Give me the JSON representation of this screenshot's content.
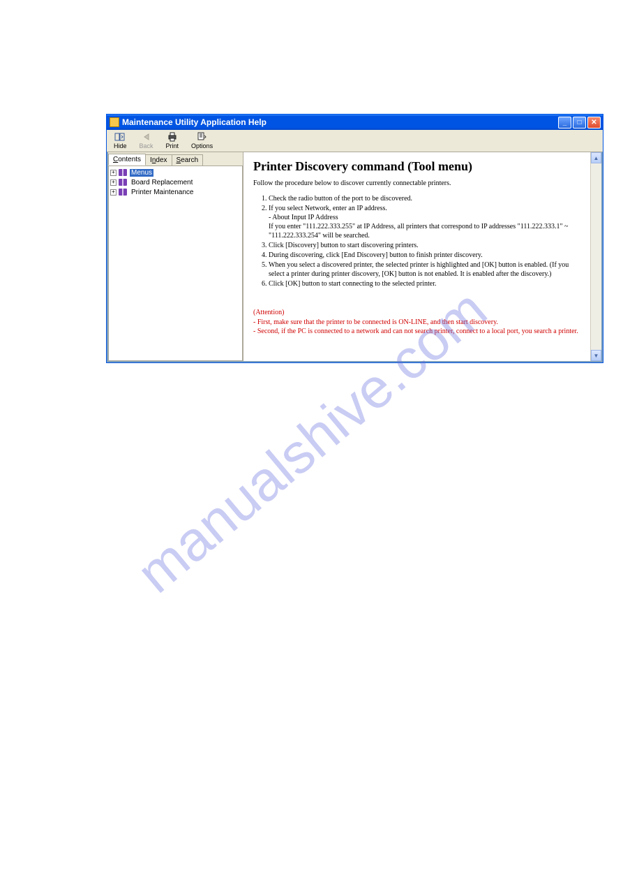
{
  "window": {
    "title": "Maintenance Utility Application Help"
  },
  "toolbar": {
    "hide": "Hide",
    "back": "Back",
    "print": "Print",
    "options": "Options"
  },
  "tabs": {
    "contents": "Contents",
    "contents_u": "C",
    "index": "Index",
    "index_u": "n",
    "search": "Search",
    "search_u": "S"
  },
  "tree": {
    "items": [
      {
        "label": "Menus",
        "selected": true
      },
      {
        "label": "Board Replacement",
        "selected": false
      },
      {
        "label": "Printer Maintenance",
        "selected": false
      }
    ]
  },
  "content": {
    "heading": "Printer Discovery command (Tool menu)",
    "intro": "Follow the procedure below to discover currently connectable printers.",
    "steps": [
      "Check the radio button of the port to be discovered.",
      "If you select Network, enter an IP address.",
      "Click [Discovery] button to start discovering printers.",
      "During discovering, click [End Discovery] button to finish printer discovery.",
      "When you select a discovered printer, the selected printer is highlighted and [OK] button is enabled. (If you select a printer during printer discovery, [OK] button is not enabled. It is enabled after the discovery.)",
      "Click [OK] button to start connecting to the selected printer."
    ],
    "step2_sub1": "- About Input IP Address",
    "step2_sub2": "If you enter \"111.222.333.255\" at IP Address, all printers that correspond to IP addresses \"111.222.333.1\" ~ \"111.222.333.254\" will be searched.",
    "attention_label": "(Attention)",
    "attention_line1": "- First, make sure that the printer to be connected is ON-LINE, and then start discovery.",
    "attention_line2": "- Second, if the PC is connected to a network and can not search printer, connect to a local port, you search a printer."
  },
  "watermark": "manualshive.com"
}
